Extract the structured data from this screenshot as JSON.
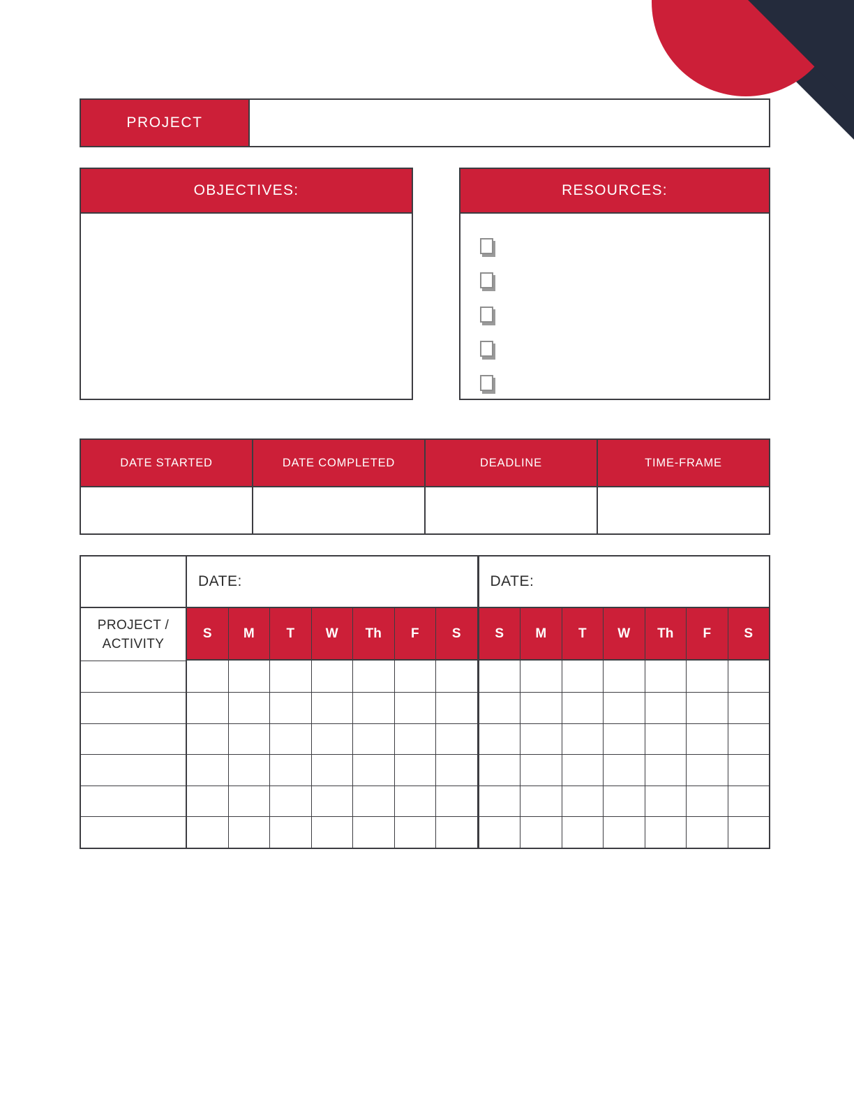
{
  "theme": {
    "red": "#CC1F38",
    "navy": "#242B3C",
    "line": "#3C3C41",
    "paper": "#FFFFFF"
  },
  "decoration": {
    "corner_navy_name": "navy-corner-triangle",
    "corner_red_name": "red-corner-circle"
  },
  "project_row": {
    "label": "PROJECT",
    "value": "",
    "placeholder": ""
  },
  "objectives": {
    "title": "OBJECTIVES:",
    "value": "",
    "placeholder": ""
  },
  "resources": {
    "title": "RESOURCES:",
    "items": [
      {
        "checked": false,
        "label": ""
      },
      {
        "checked": false,
        "label": ""
      },
      {
        "checked": false,
        "label": ""
      },
      {
        "checked": false,
        "label": ""
      },
      {
        "checked": false,
        "label": ""
      }
    ]
  },
  "date_status": {
    "headers": [
      "DATE STARTED",
      "DATE COMPLETED",
      "DEADLINE",
      "TIME-FRAME"
    ],
    "values": [
      "",
      "",
      "",
      ""
    ]
  },
  "weekly_tracker": {
    "activity_header_line1": "PROJECT /",
    "activity_header_line2": "ACTIVITY",
    "week1": {
      "date_label": "DATE:",
      "date_value": "",
      "days": [
        "S",
        "M",
        "T",
        "W",
        "Th",
        "F",
        "S"
      ]
    },
    "week2": {
      "date_label": "DATE:",
      "date_value": "",
      "days": [
        "S",
        "M",
        "T",
        "W",
        "Th",
        "F",
        "S"
      ]
    },
    "rows": [
      {
        "activity": "",
        "week1": [
          "",
          "",
          "",
          "",
          "",
          "",
          ""
        ],
        "week2": [
          "",
          "",
          "",
          "",
          "",
          "",
          ""
        ]
      },
      {
        "activity": "",
        "week1": [
          "",
          "",
          "",
          "",
          "",
          "",
          ""
        ],
        "week2": [
          "",
          "",
          "",
          "",
          "",
          "",
          ""
        ]
      },
      {
        "activity": "",
        "week1": [
          "",
          "",
          "",
          "",
          "",
          "",
          ""
        ],
        "week2": [
          "",
          "",
          "",
          "",
          "",
          "",
          ""
        ]
      },
      {
        "activity": "",
        "week1": [
          "",
          "",
          "",
          "",
          "",
          "",
          ""
        ],
        "week2": [
          "",
          "",
          "",
          "",
          "",
          "",
          ""
        ]
      },
      {
        "activity": "",
        "week1": [
          "",
          "",
          "",
          "",
          "",
          "",
          ""
        ],
        "week2": [
          "",
          "",
          "",
          "",
          "",
          "",
          ""
        ]
      },
      {
        "activity": "",
        "week1": [
          "",
          "",
          "",
          "",
          "",
          "",
          ""
        ],
        "week2": [
          "",
          "",
          "",
          "",
          "",
          "",
          ""
        ]
      }
    ]
  }
}
